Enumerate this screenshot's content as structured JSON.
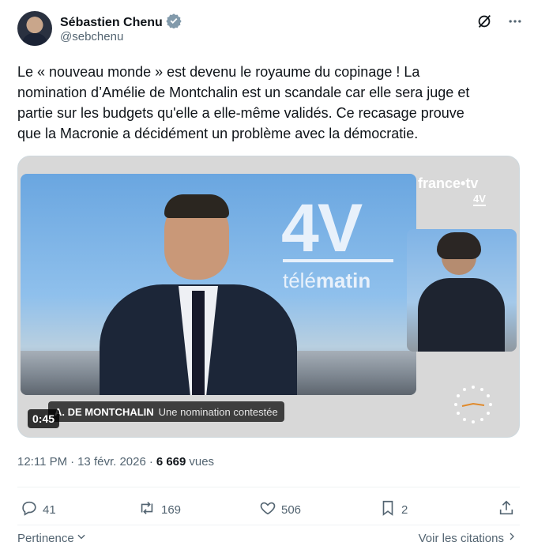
{
  "author": {
    "name": "Sébastien Chenu",
    "handle": "@sebchenu"
  },
  "tweet": {
    "lines": [
      "Le « nouveau monde » est devenu le royaume du copinage ! La",
      "nomination d’Amélie de Montchalin est un scandale car elle sera juge et",
      "partie sur les budgets qu'elle a elle-même validés. Ce recasage prouve",
      "que la Macronie a décidément un problème avec la démocratie."
    ]
  },
  "video": {
    "channel_logo": "france•tv",
    "channel_sub": "4V",
    "studio_big": "4V",
    "studio_show_prefix": "télé",
    "studio_show_suffix": "matin",
    "lower_third_caps": "A. DE MONTCHALIN",
    "lower_third_sub": "Une nomination contestée",
    "timecode": "0:45"
  },
  "meta": {
    "time": "12:11 PM",
    "dot1": "·",
    "date": "13 févr. 2026",
    "dot2": "·",
    "views_count": "6 669",
    "views_label": "vues"
  },
  "actions": {
    "replies": "41",
    "reposts": "169",
    "likes": "506",
    "bookmarks": "2"
  },
  "footer": {
    "sort_label": "Pertinence",
    "quotes_label": "Voir les citations"
  },
  "colors": {
    "text": "#0f1419",
    "secondary": "#536471",
    "verified": "#829aab",
    "border": "#cfd9de"
  }
}
